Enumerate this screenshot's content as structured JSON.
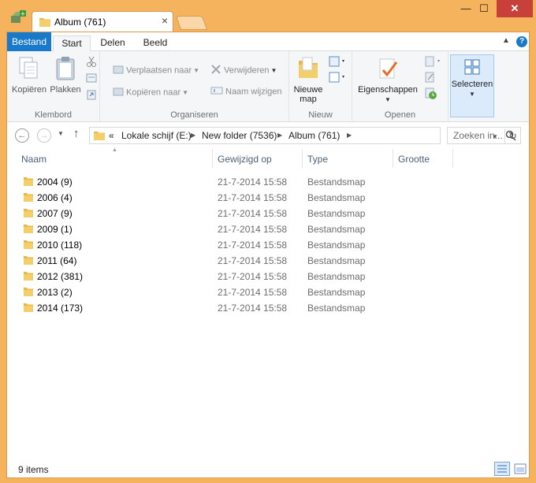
{
  "window": {
    "tab_title": "Album (761)",
    "close_symbol": "✕",
    "minimize_symbol": "—",
    "maximize_symbol": "☐"
  },
  "ribbon": {
    "tabs": [
      "Bestand",
      "Start",
      "Delen",
      "Beeld"
    ],
    "help_label": "?",
    "groups": {
      "klembord": {
        "label": "Klembord",
        "copy": "Kopiëren",
        "paste": "Plakken"
      },
      "organiseren": {
        "label": "Organiseren",
        "move_to": "Verplaatsen naar",
        "copy_to": "Kopiëren naar",
        "delete": "Verwijderen",
        "rename": "Naam wijzigen"
      },
      "nieuw": {
        "label": "Nieuw",
        "new_folder_line1": "Nieuwe",
        "new_folder_line2": "map"
      },
      "openen": {
        "label": "Openen",
        "properties": "Eigenschappen"
      },
      "selecteren": {
        "label": "Selecteren"
      }
    }
  },
  "address": {
    "overflow": "«",
    "crumbs": [
      "Lokale schijf (E:)",
      "New folder (7536)",
      "Album (761)"
    ],
    "search_placeholder": "Zoeken in..."
  },
  "columns": [
    "Naam",
    "Gewijzigd op",
    "Type",
    "Grootte"
  ],
  "rows": [
    {
      "name": "2004 (9)",
      "date": "21-7-2014 15:58",
      "type": "Bestandsmap"
    },
    {
      "name": "2006 (4)",
      "date": "21-7-2014 15:58",
      "type": "Bestandsmap"
    },
    {
      "name": "2007 (9)",
      "date": "21-7-2014 15:58",
      "type": "Bestandsmap"
    },
    {
      "name": "2009 (1)",
      "date": "21-7-2014 15:58",
      "type": "Bestandsmap"
    },
    {
      "name": "2010 (118)",
      "date": "21-7-2014 15:58",
      "type": "Bestandsmap"
    },
    {
      "name": "2011 (64)",
      "date": "21-7-2014 15:58",
      "type": "Bestandsmap"
    },
    {
      "name": "2012 (381)",
      "date": "21-7-2014 15:58",
      "type": "Bestandsmap"
    },
    {
      "name": "2013 (2)",
      "date": "21-7-2014 15:58",
      "type": "Bestandsmap"
    },
    {
      "name": "2014 (173)",
      "date": "21-7-2014 15:58",
      "type": "Bestandsmap"
    }
  ],
  "status": {
    "item_count": "9 items"
  },
  "colors": {
    "frame": "#F6B35E",
    "accent": "#1979CA",
    "folder": "#E8B84A",
    "close": "#C7403A"
  }
}
